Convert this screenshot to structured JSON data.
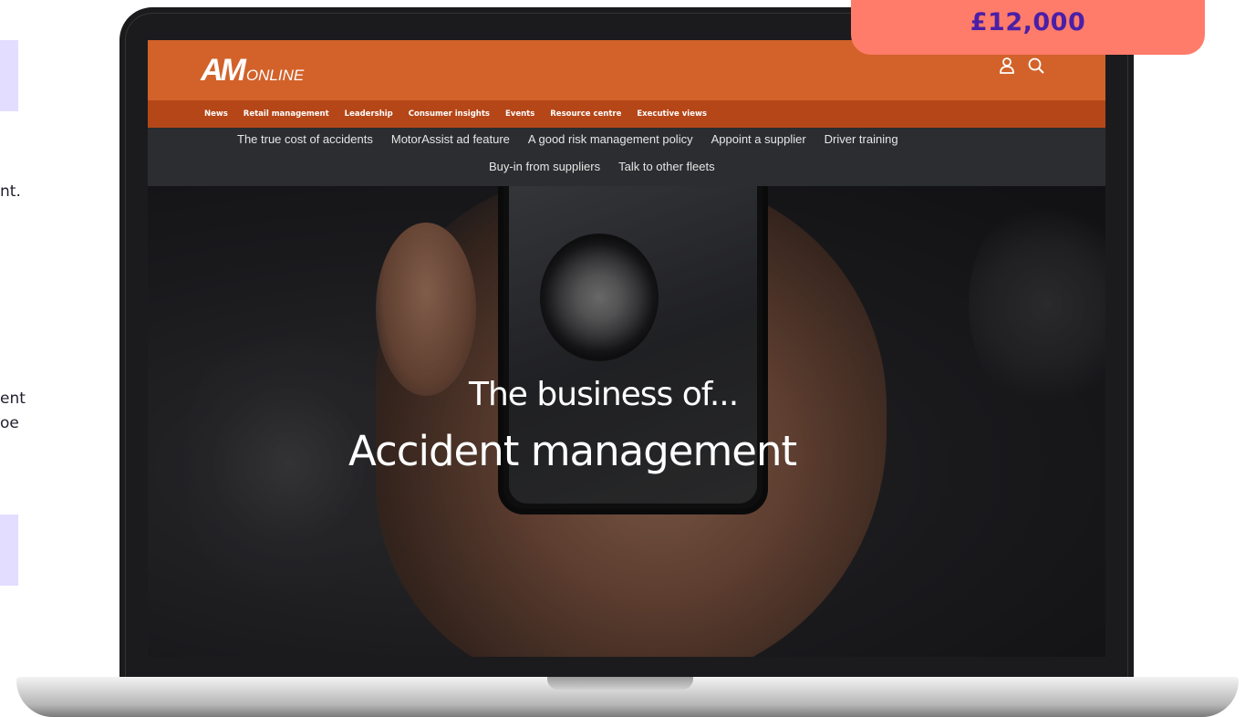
{
  "left_panel": {
    "text_line_1": "nt.",
    "text_line_2": "ent",
    "text_line_3": "oe"
  },
  "price_badge": {
    "value": "£12,000"
  },
  "site": {
    "logo": {
      "am": "AM",
      "online": "ONLINE"
    },
    "header_icons": [
      "user-icon",
      "search-icon"
    ],
    "primary_nav": [
      "News",
      "Retail management",
      "Leadership",
      "Consumer insights",
      "Events",
      "Resource centre",
      "Executive views"
    ],
    "sub_nav_row1": [
      "The true cost of accidents",
      "MotorAssist ad feature",
      "A good risk management policy",
      "Appoint a supplier",
      "Driver training"
    ],
    "sub_nav_row2": [
      "Buy-in from suppliers",
      "Talk to other fleets"
    ],
    "hero": {
      "subtitle": "The business of...",
      "title": "Accident management"
    },
    "colors": {
      "header": "#d2622a",
      "primary_nav": "#b54618",
      "sub_nav": "#2b2d30",
      "badge": "#ff7b6a",
      "badge_text": "#4a1fa8"
    }
  }
}
